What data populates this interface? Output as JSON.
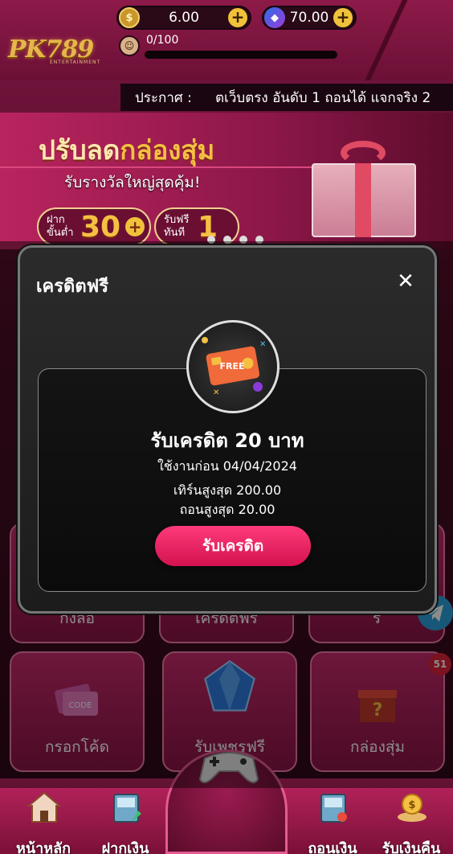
{
  "header": {
    "logo": "PK789",
    "logo_sub": "ENTERTAINMENT",
    "coin_balance": "6.00",
    "gem_balance": "70.00",
    "exp_text": "0/100",
    "exp_progress": 0
  },
  "announcement": {
    "label": "ประกาศ :",
    "text": "ตเว็บตรง อันดับ 1 ถอนได้ แจกจริง 2"
  },
  "banner": {
    "title_part1": "ปรับลด",
    "title_part2": "กล่องสุ่ม",
    "subtitle": "รับรางวัลใหญ่สุดคุ้ม!",
    "promo1_small": "ฝาก ขั้นต่ำ",
    "promo1_big": "30",
    "promo2_small": "รับฟรี ทันที",
    "promo2_big": "1"
  },
  "tiles": [
    {
      "label": "กงลอ"
    },
    {
      "label": "เครดตฟร"
    },
    {
      "label": "ร"
    },
    {
      "label": "กรอกโค้ด"
    },
    {
      "label": "รับเพชรฟรี"
    },
    {
      "label": "กล่องสุ่ม"
    }
  ],
  "notification_count": "51",
  "bottom_nav": [
    {
      "label": "หน้าหลัก",
      "icon": "home-icon"
    },
    {
      "label": "ฝากเงิน",
      "icon": "deposit-icon"
    },
    {
      "label": "ถอนเงิน",
      "icon": "withdraw-icon"
    },
    {
      "label": "รับเงินคืน",
      "icon": "cashback-icon"
    }
  ],
  "modal": {
    "title": "เครดิตฟรี",
    "close_icon": "close-icon",
    "card_icon_text": "FREE",
    "credit_title": "รับเครดิต 20 บาท",
    "expiry": "ใช้งานก่อน 04/04/2024",
    "max_turnover": "เทิร์นสูงสุด 200.00",
    "max_withdraw": "ถอนสูงสุด 20.00",
    "claim_button": "รับเครดิต"
  },
  "colors": {
    "brand": "#8d1a49",
    "accent_gold": "#f0c23a",
    "claim_pink": "#e81d5f"
  }
}
